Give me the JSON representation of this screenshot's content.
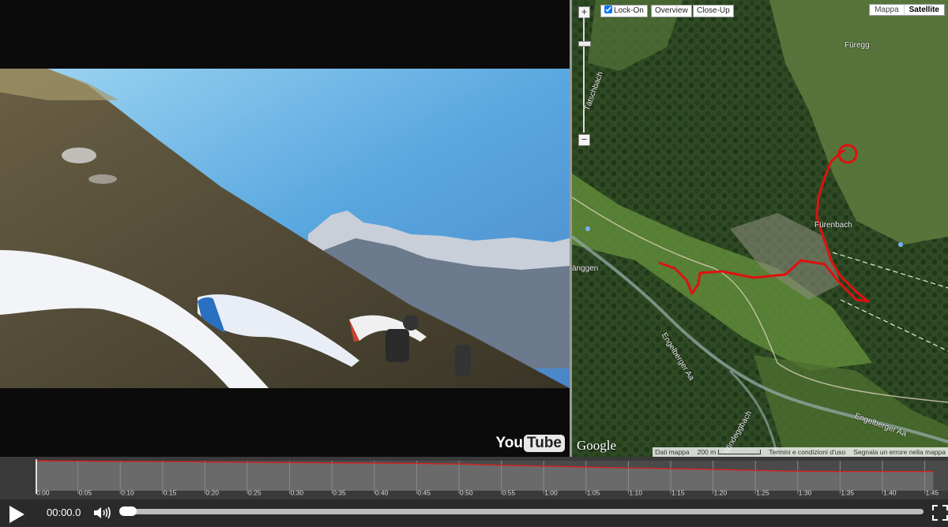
{
  "video": {
    "logo_you": "You",
    "logo_tube": "Tube"
  },
  "map": {
    "zoom_in": "+",
    "zoom_out": "−",
    "buttons": {
      "lock_on": "Lock-On",
      "overview": "Overview",
      "close_up": "Close-Up"
    },
    "lock_on_checked": true,
    "map_types": [
      "Mappa",
      "Satellite"
    ],
    "active_map_type": "Satellite",
    "places": [
      "Füregg",
      "Tätschbach",
      "Fürenbach",
      "änggen",
      "Engelberger Aa",
      "Engelberger Aa",
      "Windeggbach"
    ],
    "google_logo": "Google",
    "attribution": {
      "data": "Dati mappa",
      "scale": "200 m",
      "terms": "Termini e condizioni d'uso",
      "report": "Segnala un errore nella mappa"
    },
    "colors": {
      "track": "#e01010",
      "water": "#7a8f8a"
    }
  },
  "timeline": {
    "tick_labels": [
      "0:00",
      "0:05",
      "0:10",
      "0:15",
      "0:20",
      "0:25",
      "0:30",
      "0:35",
      "0:40",
      "0:45",
      "0:50",
      "0:55",
      "1:00",
      "1:05",
      "1:10",
      "1:15",
      "1:20",
      "1:25",
      "1:30",
      "1:35",
      "1:40",
      "1:45"
    ],
    "altitude_profile": [
      [
        0,
        1.0
      ],
      [
        5,
        0.99
      ],
      [
        10,
        0.98
      ],
      [
        15,
        0.97
      ],
      [
        20,
        0.96
      ],
      [
        25,
        0.95
      ],
      [
        30,
        0.94
      ],
      [
        35,
        0.93
      ],
      [
        40,
        0.92
      ],
      [
        45,
        0.91
      ],
      [
        50,
        0.89
      ],
      [
        55,
        0.85
      ],
      [
        60,
        0.82
      ],
      [
        65,
        0.79
      ],
      [
        70,
        0.76
      ],
      [
        75,
        0.74
      ],
      [
        80,
        0.71
      ],
      [
        85,
        0.68
      ],
      [
        90,
        0.65
      ],
      [
        95,
        0.64
      ],
      [
        100,
        0.64
      ],
      [
        106,
        0.64
      ]
    ],
    "colors": {
      "line": "#d42020",
      "fill": "#6a6a6a",
      "grid": "#8a8a8a"
    }
  },
  "controls": {
    "current_time": "00:00.0",
    "progress": 0.0
  }
}
